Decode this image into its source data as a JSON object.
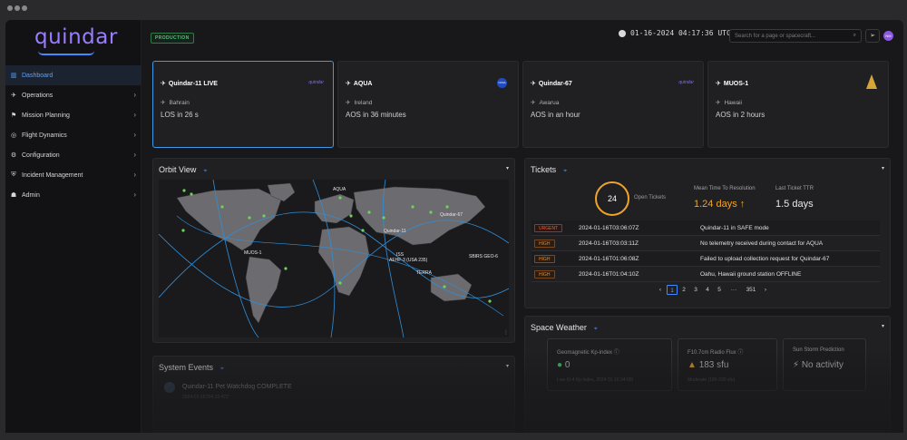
{
  "app": {
    "logo_text": "quindar",
    "environment_badge": "PRODUCTION",
    "clock": "01-16-2024 04:17:36 UTC",
    "search_placeholder": "Search for a page or spacecraft...",
    "avatar_initials": "NM"
  },
  "sidebar": {
    "items": [
      {
        "label": "Dashboard",
        "icon": "chart-icon"
      },
      {
        "label": "Operations",
        "icon": "satellite-icon"
      },
      {
        "label": "Mission Planning",
        "icon": "flag-icon"
      },
      {
        "label": "Flight Dynamics",
        "icon": "orbit-icon"
      },
      {
        "label": "Configuration",
        "icon": "gear-icon"
      },
      {
        "label": "Incident Management",
        "icon": "shield-icon"
      },
      {
        "label": "Admin",
        "icon": "users-icon"
      }
    ]
  },
  "spacecraft": [
    {
      "name": "Quindar-11 LIVE",
      "station": "Bahrain",
      "status": "LOS in 26 s",
      "logo": "quindar-logo"
    },
    {
      "name": "AQUA",
      "station": "Ireland",
      "status": "AOS in 36 minutes",
      "logo": "nasa-logo"
    },
    {
      "name": "Quindar-67",
      "station": "Awarua",
      "status": "AOS in an hour",
      "logo": "quindar-logo"
    },
    {
      "name": "MUOS-1",
      "station": "Hawaii",
      "status": "AOS in 2 hours",
      "logo": "cone-logo"
    }
  ],
  "spacecraft_logo_text": "quindar",
  "nasa_logo_text": "NASA",
  "orbit_view": {
    "title": "Orbit View",
    "labels": [
      "AQUA",
      "Quindar-67",
      "Quindar-11",
      "MUOS-1",
      "ISS",
      "AEHF-3 (USA 235)",
      "TERRA",
      "SBIRS GEO-6"
    ]
  },
  "tickets": {
    "title": "Tickets",
    "open_count": "24",
    "open_label": "Open Tickets",
    "mttr_label": "Mean Time To Resolution",
    "mttr_value": "1.24 days ↑",
    "last_ttr_label": "Last Ticket TTR",
    "last_ttr_value": "1.5 days",
    "rows": [
      {
        "severity": "URGENT",
        "time": "2024-01-16T03:06:07Z",
        "description": "Quindar-11 in SAFE mode"
      },
      {
        "severity": "HIGH",
        "time": "2024-01-16T03:03:11Z",
        "description": "No telemetry received during contact for AQUA"
      },
      {
        "severity": "HIGH",
        "time": "2024-01-16T01:06:08Z",
        "description": "Failed to upload collection request for Quindar-67"
      },
      {
        "severity": "HIGH",
        "time": "2024-01-16T01:04:10Z",
        "description": "Oahu, Hawaii ground station OFFLINE"
      }
    ],
    "pager": [
      "‹",
      "1",
      "2",
      "3",
      "4",
      "5",
      "···",
      "351",
      "›"
    ]
  },
  "space_weather": {
    "title": "Space Weather",
    "kp_label": "Geomagnetic Kp-index ⓘ",
    "kp_value": "0",
    "kp_sub": "Low (0-4 Kp Index, 2024 01-16 04:00)",
    "flux_label": "F10.7cm Radio Flux ⓘ",
    "flux_value": "183 sfu",
    "flux_sub": "Moderate (180-200 sfu)",
    "storm_label": "Sun Storm Prediction",
    "storm_value": "No activity"
  },
  "system_events": {
    "title": "System Events",
    "event": "Quindar-11 Pet Watchdog COMPLETE",
    "event_sub": "2024-01-16T04:15:47Z"
  }
}
